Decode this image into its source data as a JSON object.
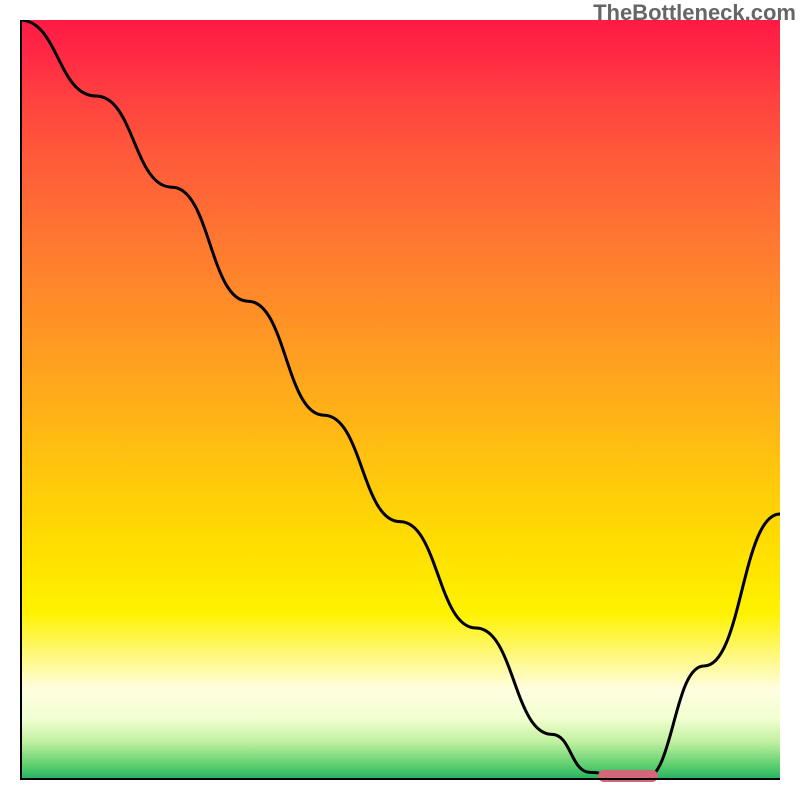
{
  "watermark": "TheBottleneck.com",
  "chart_data": {
    "type": "line",
    "title": "",
    "xlabel": "",
    "ylabel": "",
    "x_range": [
      0,
      100
    ],
    "y_range": [
      0,
      100
    ],
    "series": [
      {
        "name": "bottleneck-curve",
        "x": [
          0,
          10,
          20,
          30,
          40,
          50,
          60,
          70,
          75,
          80,
          82,
          90,
          100
        ],
        "values": [
          100,
          90,
          78,
          63,
          48,
          34,
          20,
          6,
          1,
          0,
          0,
          15,
          35
        ]
      }
    ],
    "marker": {
      "name": "optimal-range",
      "x_start": 76,
      "x_end": 84,
      "y": 0,
      "color": "#d4667a"
    },
    "gradient_stops": [
      {
        "pos": 0,
        "color": "#ff1a44"
      },
      {
        "pos": 5,
        "color": "#ff2a44"
      },
      {
        "pos": 10,
        "color": "#ff4040"
      },
      {
        "pos": 18,
        "color": "#ff5a3a"
      },
      {
        "pos": 30,
        "color": "#ff7a30"
      },
      {
        "pos": 45,
        "color": "#ffa020"
      },
      {
        "pos": 57,
        "color": "#ffc010"
      },
      {
        "pos": 70,
        "color": "#ffe000"
      },
      {
        "pos": 78,
        "color": "#fff200"
      },
      {
        "pos": 88,
        "color": "#fffde0"
      },
      {
        "pos": 92,
        "color": "#f0ffd0"
      },
      {
        "pos": 95,
        "color": "#c0f0a0"
      },
      {
        "pos": 98,
        "color": "#60d070"
      },
      {
        "pos": 100,
        "color": "#20b060"
      }
    ]
  }
}
